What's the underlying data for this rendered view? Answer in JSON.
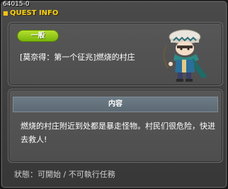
{
  "window": {
    "quest_id": "64015-0",
    "title": "QUEST INFO"
  },
  "quest": {
    "category": "一般",
    "name": "[莫奈得：第一个征兆]燃烧的村庄",
    "npc_image": "npc-character-icon"
  },
  "content": {
    "header": "内容",
    "description": "燃烧的村庄附近到处都是暴走怪物。村民们很危险，快进去救人!"
  },
  "status": {
    "text": "狀態：可開始 / 不可執行任務"
  },
  "colors": {
    "title_yellow": "#f7d21a",
    "badge_green": "#8cc615",
    "header_bar": "#647380"
  }
}
